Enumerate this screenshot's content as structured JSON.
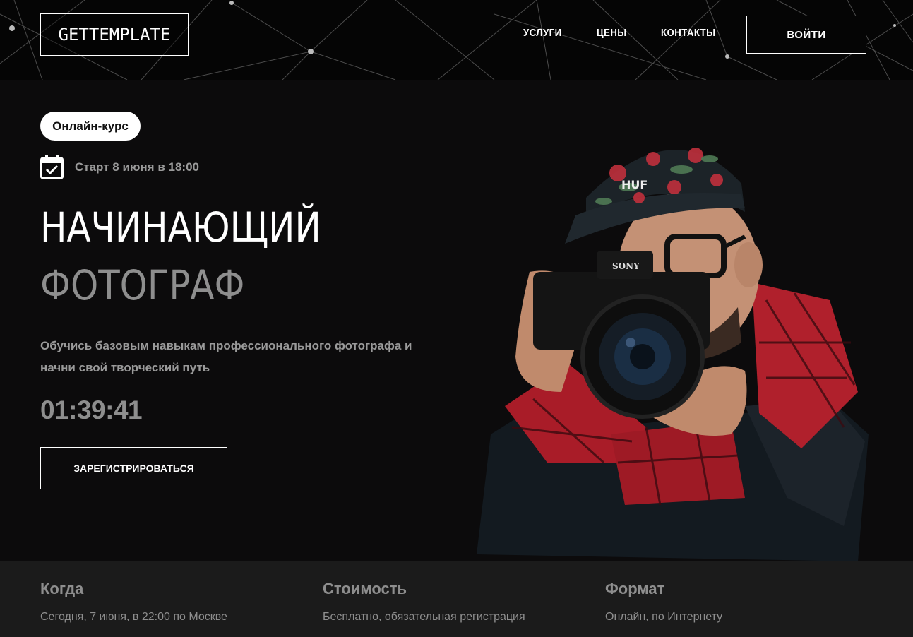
{
  "header": {
    "logo": "GETTEMPLATE",
    "nav": [
      "УСЛУГИ",
      "ЦЕНЫ",
      "КОНТАКТЫ"
    ],
    "login": "ВОЙТИ"
  },
  "hero": {
    "badge": "Онлайн-курс",
    "start": "Старт 8 июня в 18:00",
    "title_line1": "НАЧИНАЮЩИЙ",
    "title_line2": "ФОТОГРАФ",
    "description": "Обучись базовым навыкам профессионального фотографа и начни свой творческий путь",
    "timer": "01:39:41",
    "register_button": "ЗАРЕГИСТРИРОВАТЬСЯ",
    "photo_alt": "photographer-with-camera"
  },
  "info": [
    {
      "heading": "Когда",
      "value": "Сегодня, 7 июня, в 22:00 по Москве"
    },
    {
      "heading": "Стоимость",
      "value": "Бесплатно, обязательная регистрация"
    },
    {
      "heading": "Формат",
      "value": "Онлайн, по Интернету"
    }
  ],
  "colors": {
    "background": "#0c0b0c",
    "info_strip": "#1b1b1b",
    "muted_text": "#8e8e8e",
    "shirt_red": "#b0202c"
  }
}
